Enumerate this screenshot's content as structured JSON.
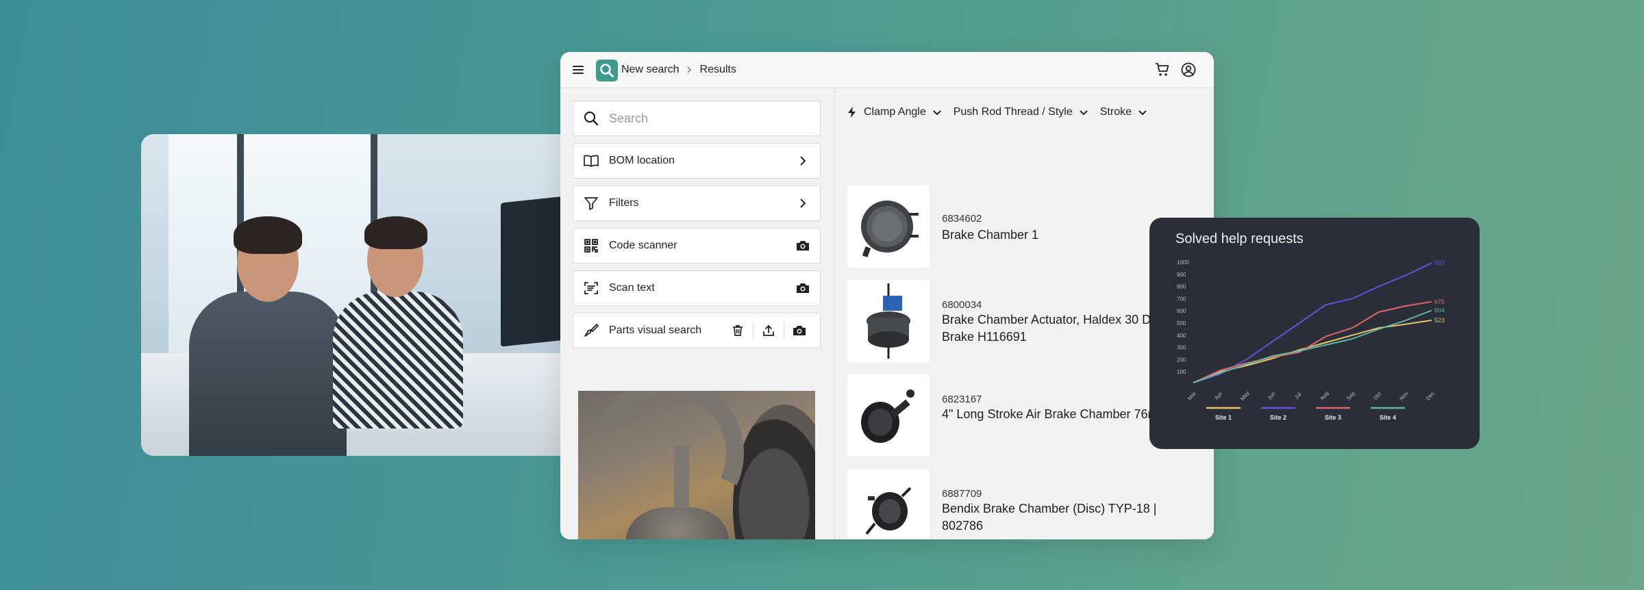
{
  "topbar": {
    "crumb_new_search": "New search",
    "crumb_results": "Results"
  },
  "sidebar": {
    "search_placeholder": "Search",
    "bom_location": "BOM location",
    "filters": "Filters",
    "code_scanner": "Code scanner",
    "scan_text": "Scan text",
    "parts_visual_search": "Parts visual search"
  },
  "filter_chips": [
    "Clamp Angle",
    "Push Rod Thread / Style",
    "Stroke"
  ],
  "results": [
    {
      "number": "6834602",
      "name": "Brake Chamber 1"
    },
    {
      "number": "6800034",
      "name": "Brake Chamber Actuator, Haldex 30 Drum Brake H116691"
    },
    {
      "number": "6823167",
      "name": "4\" Long Stroke Air Brake Chamber 76mm"
    },
    {
      "number": "6887709",
      "name": "Bendix Brake Chamber (Disc) TYP-18 | 802786"
    }
  ],
  "colors": {
    "accent": "#3e9b8c",
    "card_bg": "#2a2e38",
    "site1": "#e8c46a",
    "site2": "#6a4fd6",
    "site3": "#e0666a",
    "site4": "#5fb8a4"
  },
  "chart_data": {
    "type": "line",
    "title": "Solved help requests",
    "categories": [
      "Mar",
      "Apr",
      "May",
      "Jun",
      "Jul",
      "Aug",
      "Sep",
      "Oct",
      "Nov",
      "Dec"
    ],
    "yticks": [
      100,
      200,
      300,
      400,
      500,
      600,
      700,
      800,
      900,
      1000
    ],
    "ylim": [
      0,
      1000
    ],
    "grid": false,
    "legend_position": "bottom",
    "series": [
      {
        "name": "Site 1",
        "color": "#e8c46a",
        "values": [
          10,
          100,
          150,
          210,
          280,
          340,
          400,
          460,
          490,
          523
        ],
        "end_label": "523"
      },
      {
        "name": "Site 2",
        "color": "#6a4fd6",
        "values": [
          10,
          80,
          200,
          350,
          500,
          650,
          700,
          800,
          890,
          993
        ],
        "end_label": "993"
      },
      {
        "name": "Site 3",
        "color": "#e0666a",
        "values": [
          10,
          110,
          170,
          220,
          260,
          390,
          460,
          590,
          640,
          675
        ],
        "end_label": "675"
      },
      {
        "name": "Site 4",
        "color": "#5fb8a4",
        "values": [
          10,
          90,
          160,
          230,
          270,
          320,
          370,
          450,
          520,
          604
        ],
        "end_label": "604"
      }
    ]
  }
}
